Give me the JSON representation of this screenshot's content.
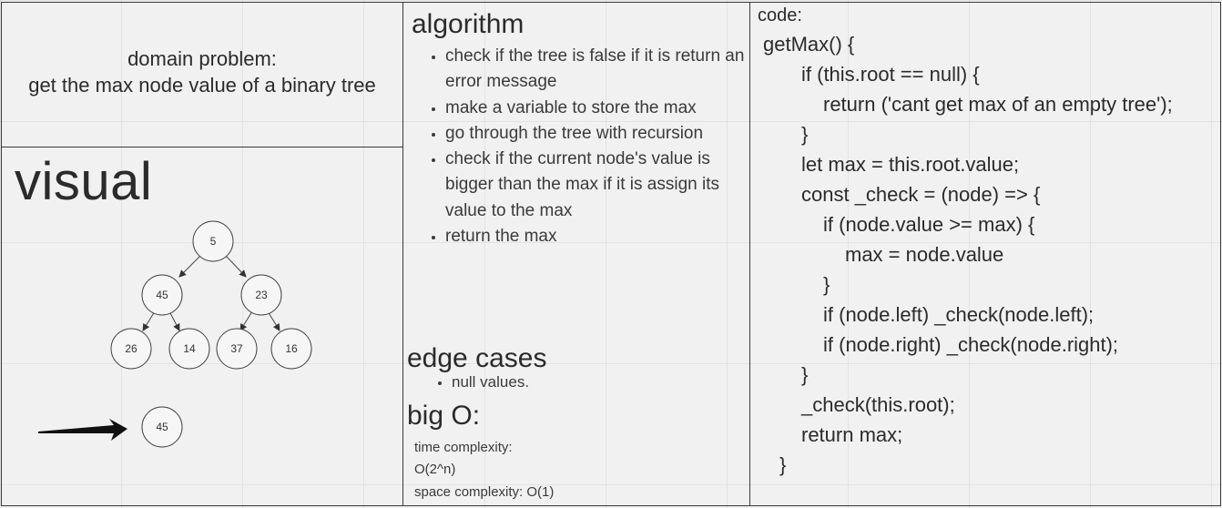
{
  "domain": {
    "line1": "domain problem:",
    "line2": "get the max node value of a binary tree"
  },
  "visual": {
    "title": "visual",
    "tree": {
      "root": "5",
      "level1": [
        "45",
        "23"
      ],
      "level2": [
        "26",
        "14",
        "37",
        "16"
      ]
    },
    "result": "45"
  },
  "algorithm": {
    "title": "algorithm",
    "steps": [
      "check if the tree is false if it is return an error message",
      "make a variable to store the max",
      "go through the tree with recursion",
      "check if the current node's value is bigger than the max if it is assign its value to the max",
      "return the max"
    ]
  },
  "edge_cases": {
    "title": "edge cases",
    "items": [
      "null values."
    ]
  },
  "big_o": {
    "title": "big O:",
    "lines": [
      "time complexity:",
      "O(2^n)",
      "space complexity: O(1)"
    ]
  },
  "code": {
    "label": "code:",
    "lines": [
      "getMax() {",
      "if (this.root == null) {",
      "return ('cant get max of an empty tree');",
      "}",
      "let max = this.root.value;",
      "const _check = (node) => {",
      "if (node.value >= max) {",
      "max = node.value",
      "}",
      "if (node.left) _check(node.left);",
      "if (node.right) _check(node.right);",
      "}",
      "_check(this.root);",
      "return max;",
      "}"
    ]
  }
}
